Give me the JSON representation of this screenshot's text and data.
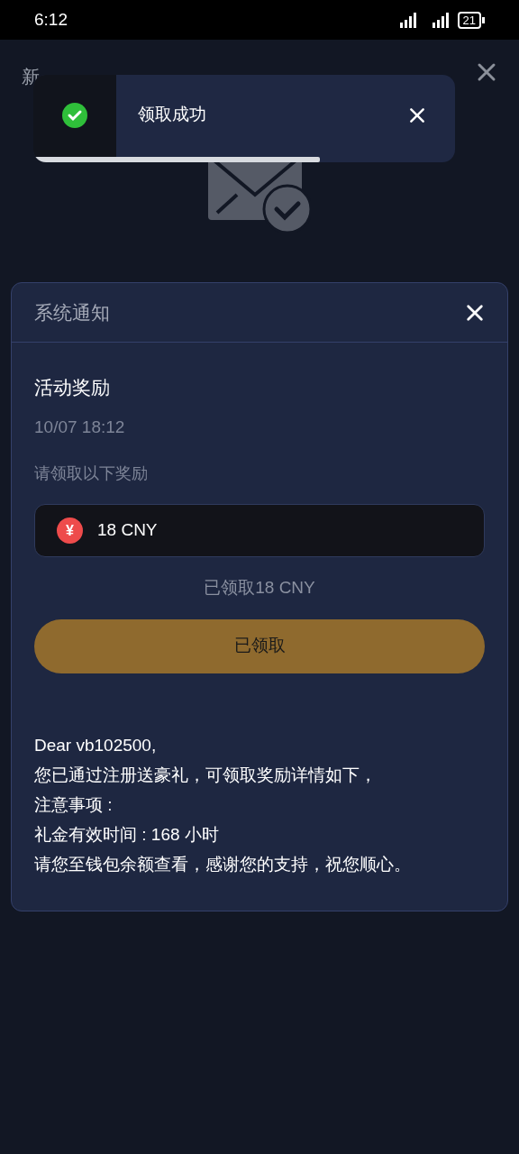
{
  "status_bar": {
    "time": "6:12",
    "battery": "21"
  },
  "page": {
    "title": "新"
  },
  "toast": {
    "message": "领取成功",
    "level": 0.68
  },
  "modal": {
    "title": "系统通知",
    "heading": "活动奖励",
    "date": "10/07 18:12",
    "prompt": "请领取以下奖励",
    "reward": {
      "symbol": "¥",
      "amount": "18 CNY"
    },
    "claimed_note": "已领取18 CNY",
    "button": {
      "label": "已领取",
      "disabled": true
    },
    "body": [
      "Dear vb102500,",
      "您已通过注册送豪礼，可领取奖励详情如下，",
      "注意事项 :",
      "礼金有效时间 : 168 小时",
      "请您至钱包余额查看，感谢您的支持，祝您顺心。"
    ]
  }
}
